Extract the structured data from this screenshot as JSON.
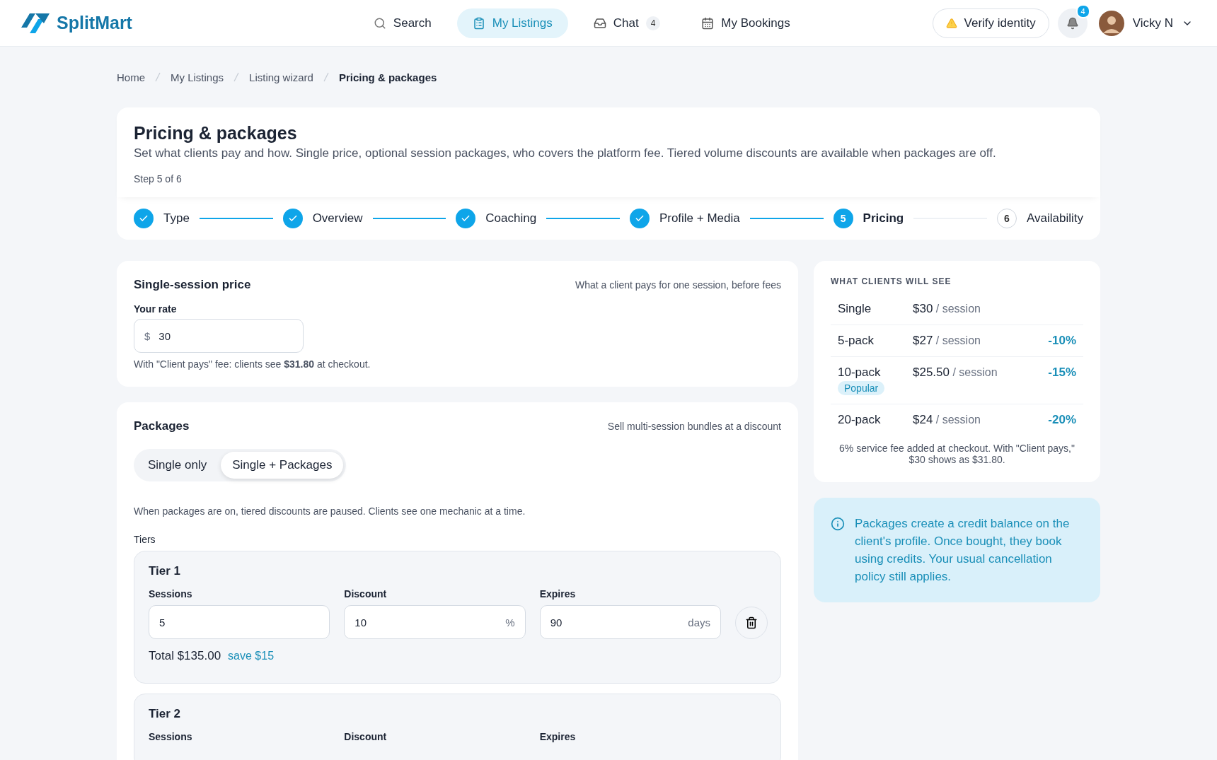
{
  "header": {
    "brand": "SplitMart",
    "nav": [
      {
        "label": "Search",
        "selected": false
      },
      {
        "label": "My Listings",
        "selected": true
      },
      {
        "label": "Chat",
        "selected": false,
        "badge": "4"
      },
      {
        "label": "My Bookings",
        "selected": false
      }
    ],
    "verify_button": "Verify identity",
    "notifications_badge": "4",
    "user_name": "Vicky N"
  },
  "breadcrumb": [
    {
      "label": "Home",
      "current": false
    },
    {
      "label": "My Listings",
      "current": false
    },
    {
      "label": "Listing wizard",
      "current": false
    },
    {
      "label": "Pricing & packages",
      "current": true
    }
  ],
  "page": {
    "title": "Pricing & packages",
    "subtitle": "Set what clients pay and how. Single price, optional session packages, who covers the platform fee. Tiered volume discounts are available when packages are off.",
    "step": "Step 5 of 6"
  },
  "stepper": [
    {
      "label": "Type",
      "done": true,
      "selected": false
    },
    {
      "label": "Overview",
      "done": true,
      "selected": false
    },
    {
      "label": "Coaching",
      "done": true,
      "selected": false
    },
    {
      "label": "Profile + Media",
      "done": true,
      "selected": false
    },
    {
      "label": "Pricing",
      "done": false,
      "selected": true,
      "number": "5"
    },
    {
      "label": "Availability",
      "done": false,
      "selected": false,
      "number": "6"
    }
  ],
  "single_price": {
    "title": "Single-session price",
    "hint": "What a client pays for one session, before fees",
    "field_label": "Your rate",
    "prefix": "$",
    "value": "30",
    "note": "With \"Client pays\" fee: clients see **$31.80** at checkout."
  },
  "packages": {
    "title": "Packages",
    "hint": "Sell multi-session bundles at a discount",
    "options": [
      {
        "label": "Single only",
        "selected": false
      },
      {
        "label": "Single + Packages",
        "selected": true
      }
    ],
    "note": "When packages are on, tiered discounts are paused. Clients see one mechanic at a time.",
    "tiers_label": "Tiers",
    "tiers": [
      {
        "title": "Tier 1",
        "sessions_label": "Sessions",
        "sessions": "5",
        "discount_label": "Discount",
        "discount": "10",
        "discount_unit": "%",
        "expires_label": "Expires",
        "expires": "90",
        "expires_unit": "days",
        "total": "Total $135.00",
        "save": "save $15"
      },
      {
        "title": "Tier 2",
        "sessions_label": "Sessions",
        "discount_label": "Discount",
        "expires_label": "Expires"
      }
    ]
  },
  "preview": {
    "title": "WHAT CLIENTS WILL SEE",
    "rows": [
      {
        "name": "Single",
        "price": "$30",
        "unit": "/ session"
      },
      {
        "name": "5-pack",
        "price": "$27",
        "unit": "/ session",
        "discount": "-10%"
      },
      {
        "name": "10-pack",
        "badge": "Popular",
        "price": "$25.50",
        "unit": "/ session",
        "discount": "-15%"
      },
      {
        "name": "20-pack",
        "price": "$24",
        "unit": "/ session",
        "discount": "-20%"
      }
    ],
    "footnote": "6% service fee added at checkout. With \"Client pays,\" $30 shows as $31.80."
  },
  "info": "Packages create a credit balance on the client's profile. Once bought, they book using credits. Your usual cancellation policy still applies."
}
